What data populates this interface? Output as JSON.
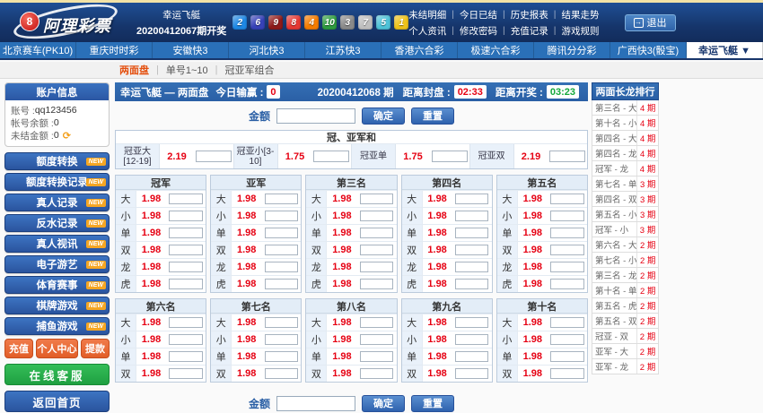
{
  "header": {
    "logo_text": "阿理彩票",
    "logo_ball": "8",
    "draw_label": "幸运飞艇",
    "draw_number": "20200412067期开奖",
    "balls": [
      [
        "2",
        "#1e88e5"
      ],
      [
        "6",
        "#3742b8"
      ],
      [
        "9",
        "#8e1a1a"
      ],
      [
        "8",
        "#e53935"
      ],
      [
        "4",
        "#f57c00"
      ],
      [
        "10",
        "#2e9e40"
      ],
      [
        "3",
        "#8a8a8a"
      ],
      [
        "7",
        "#bfbfbf"
      ],
      [
        "5",
        "#4ec3d9"
      ],
      [
        "1",
        "#efc31b"
      ]
    ],
    "links_row1": [
      "未结明细",
      "今日已结",
      "历史报表",
      "结果走势"
    ],
    "links_row2": [
      "个人资讯",
      "修改密码",
      "充值记录",
      "游戏规则"
    ],
    "logout_label": "退出"
  },
  "nav": {
    "tabs": [
      "北京赛车(PK10)",
      "重庆时时彩",
      "安徽快3",
      "河北快3",
      "江苏快3",
      "香港六合彩",
      "极速六合彩",
      "腾讯分分彩",
      "广西快3(骰宝)"
    ],
    "active_tab": "幸运飞艇 ▼"
  },
  "subnav": {
    "items": [
      "两面盘",
      "单号1~10",
      "冠亚军组合"
    ],
    "active": "两面盘"
  },
  "sidebar": {
    "account_title": "账户信息",
    "account_rows": [
      {
        "label": "账号",
        "value": "qq123456"
      },
      {
        "label": "帐号余额",
        "value": "0"
      },
      {
        "label": "未结金额",
        "value": "0"
      }
    ],
    "menu": [
      "额度转换",
      "额度转换记录",
      "真人记录",
      "反水记录",
      "真人视讯",
      "电子游艺",
      "体育赛事",
      "棋牌游戏",
      "捕鱼游戏"
    ],
    "badge": "NEW",
    "quick_buttons": [
      "充值",
      "个人中心",
      "提款"
    ],
    "service_button": "在线客服",
    "home_button": "返回首页"
  },
  "main": {
    "title": "幸运飞艇 — 两面盘",
    "today_label": "今日输赢 :",
    "today_value": "0",
    "period": "20200412068 期",
    "close_label": "距离封盘 :",
    "close_value": "02:33",
    "open_label": "距离开奖 :",
    "open_value": "03:23",
    "amount_label": "金额",
    "confirm_label": "确定",
    "reset_label": "重置",
    "combo_title": "冠、亚军和",
    "combo_bets": [
      [
        "冠亚大[12-19]",
        "2.19"
      ],
      [
        "冠亚小[3-10]",
        "1.75"
      ],
      [
        "冠亚单",
        "1.75"
      ],
      [
        "冠亚双",
        "2.19"
      ]
    ],
    "groups_row1": [
      {
        "title": "冠军",
        "bets": [
          [
            "大",
            "1.98"
          ],
          [
            "小",
            "1.98"
          ],
          [
            "单",
            "1.98"
          ],
          [
            "双",
            "1.98"
          ],
          [
            "龙",
            "1.98"
          ],
          [
            "虎",
            "1.98"
          ]
        ]
      },
      {
        "title": "亚军",
        "bets": [
          [
            "大",
            "1.98"
          ],
          [
            "小",
            "1.98"
          ],
          [
            "单",
            "1.98"
          ],
          [
            "双",
            "1.98"
          ],
          [
            "龙",
            "1.98"
          ],
          [
            "虎",
            "1.98"
          ]
        ]
      },
      {
        "title": "第三名",
        "bets": [
          [
            "大",
            "1.98"
          ],
          [
            "小",
            "1.98"
          ],
          [
            "单",
            "1.98"
          ],
          [
            "双",
            "1.98"
          ],
          [
            "龙",
            "1.98"
          ],
          [
            "虎",
            "1.98"
          ]
        ]
      },
      {
        "title": "第四名",
        "bets": [
          [
            "大",
            "1.98"
          ],
          [
            "小",
            "1.98"
          ],
          [
            "单",
            "1.98"
          ],
          [
            "双",
            "1.98"
          ],
          [
            "龙",
            "1.98"
          ],
          [
            "虎",
            "1.98"
          ]
        ]
      },
      {
        "title": "第五名",
        "bets": [
          [
            "大",
            "1.98"
          ],
          [
            "小",
            "1.98"
          ],
          [
            "单",
            "1.98"
          ],
          [
            "双",
            "1.98"
          ],
          [
            "龙",
            "1.98"
          ],
          [
            "虎",
            "1.98"
          ]
        ]
      }
    ],
    "groups_row2": [
      {
        "title": "第六名",
        "bets": [
          [
            "大",
            "1.98"
          ],
          [
            "小",
            "1.98"
          ],
          [
            "单",
            "1.98"
          ],
          [
            "双",
            "1.98"
          ]
        ]
      },
      {
        "title": "第七名",
        "bets": [
          [
            "大",
            "1.98"
          ],
          [
            "小",
            "1.98"
          ],
          [
            "单",
            "1.98"
          ],
          [
            "双",
            "1.98"
          ]
        ]
      },
      {
        "title": "第八名",
        "bets": [
          [
            "大",
            "1.98"
          ],
          [
            "小",
            "1.98"
          ],
          [
            "单",
            "1.98"
          ],
          [
            "双",
            "1.98"
          ]
        ]
      },
      {
        "title": "第九名",
        "bets": [
          [
            "大",
            "1.98"
          ],
          [
            "小",
            "1.98"
          ],
          [
            "单",
            "1.98"
          ],
          [
            "双",
            "1.98"
          ]
        ]
      },
      {
        "title": "第十名",
        "bets": [
          [
            "大",
            "1.98"
          ],
          [
            "小",
            "1.98"
          ],
          [
            "单",
            "1.98"
          ],
          [
            "双",
            "1.98"
          ]
        ]
      }
    ]
  },
  "longdragon": {
    "title": "两面长龙排行",
    "rows": [
      [
        "第三名 - 大",
        "4 期"
      ],
      [
        "第十名 - 小",
        "4 期"
      ],
      [
        "第四名 - 大",
        "4 期"
      ],
      [
        "第四名 - 龙",
        "4 期"
      ],
      [
        "冠军 - 龙",
        "4 期"
      ],
      [
        "第七名 - 单",
        "3 期"
      ],
      [
        "第四名 - 双",
        "3 期"
      ],
      [
        "第五名 - 小",
        "3 期"
      ],
      [
        "冠军 - 小",
        "3 期"
      ],
      [
        "第六名 - 大",
        "2 期"
      ],
      [
        "第七名 - 小",
        "2 期"
      ],
      [
        "第三名 - 龙",
        "2 期"
      ],
      [
        "第十名 - 单",
        "2 期"
      ],
      [
        "第五名 - 虎",
        "2 期"
      ],
      [
        "第五名 - 双",
        "2 期"
      ],
      [
        "冠亚 - 双",
        "2 期"
      ],
      [
        "亚军 - 大",
        "2 期"
      ],
      [
        "亚军 - 龙",
        "2 期"
      ]
    ]
  }
}
